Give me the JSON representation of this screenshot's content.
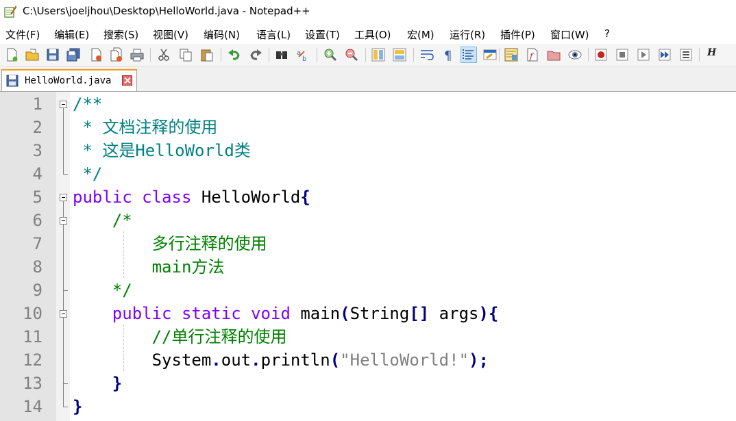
{
  "window": {
    "title": "C:\\Users\\joeljhou\\Desktop\\HelloWorld.java - Notepad++",
    "icon": "notepad-plus-plus-icon"
  },
  "menu": [
    "文件(F)",
    "编辑(E)",
    "搜索(S)",
    "视图(V)",
    "编码(N)",
    "语言(L)",
    "设置(T)",
    "工具(O)",
    "宏(M)",
    "运行(R)",
    "插件(P)",
    "窗口(W)",
    "?"
  ],
  "toolbar": {
    "icons": [
      "new-file-icon",
      "open-file-icon",
      "save-icon",
      "save-all-icon",
      "close-icon",
      "close-all-icon",
      "print-icon",
      "cut-icon",
      "copy-icon",
      "paste-icon",
      "undo-icon",
      "redo-icon",
      "find-icon",
      "replace-icon",
      "zoom-in-icon",
      "zoom-out-icon",
      "sync-vertical-icon",
      "sync-horizontal-icon",
      "word-wrap-icon",
      "show-all-chars-icon",
      "indent-guide-icon",
      "udl-icon",
      "doc-map-icon",
      "function-list-icon",
      "folder-workspace-icon",
      "monitor-icon",
      "record-macro-icon",
      "stop-macro-icon",
      "play-macro-icon",
      "run-macro-multiple-icon",
      "save-macro-icon"
    ],
    "last_label": "H"
  },
  "tab": {
    "label": "HelloWorld.java"
  },
  "editor": {
    "line_numbers": [
      "1",
      "2",
      "3",
      "4",
      "5",
      "6",
      "7",
      "8",
      "9",
      "10",
      "11",
      "12",
      "13",
      "14"
    ],
    "lines": [
      [
        {
          "t": "/**",
          "c": "cmt-doc"
        }
      ],
      [
        {
          "t": " * 文档注释的使用",
          "c": "cmt-doc"
        }
      ],
      [
        {
          "t": " * 这是HelloWorld类",
          "c": "cmt-doc"
        }
      ],
      [
        {
          "t": " */",
          "c": "cmt-doc"
        }
      ],
      [
        {
          "t": "public",
          "c": "kw"
        },
        {
          "t": " ",
          "c": "id"
        },
        {
          "t": "class",
          "c": "kw"
        },
        {
          "t": " HelloWorld",
          "c": "id"
        },
        {
          "t": "{",
          "c": "op"
        }
      ],
      [
        {
          "t": "    /*",
          "c": "cmt"
        }
      ],
      [
        {
          "t": "        多行注释的使用",
          "c": "cmt"
        }
      ],
      [
        {
          "t": "        main方法",
          "c": "cmt"
        }
      ],
      [
        {
          "t": "    */",
          "c": "cmt"
        }
      ],
      [
        {
          "t": "    ",
          "c": "id"
        },
        {
          "t": "public",
          "c": "kw"
        },
        {
          "t": " ",
          "c": "id"
        },
        {
          "t": "static",
          "c": "kw"
        },
        {
          "t": " ",
          "c": "id"
        },
        {
          "t": "void",
          "c": "kw"
        },
        {
          "t": " main",
          "c": "id"
        },
        {
          "t": "(",
          "c": "op"
        },
        {
          "t": "String",
          "c": "id"
        },
        {
          "t": "[]",
          "c": "op"
        },
        {
          "t": " args",
          "c": "id"
        },
        {
          "t": "){",
          "c": "op"
        }
      ],
      [
        {
          "t": "        //单行注释的使用",
          "c": "cmt"
        }
      ],
      [
        {
          "t": "        System",
          "c": "id"
        },
        {
          "t": ".",
          "c": "op"
        },
        {
          "t": "out",
          "c": "id"
        },
        {
          "t": ".",
          "c": "op"
        },
        {
          "t": "println",
          "c": "id"
        },
        {
          "t": "(",
          "c": "op"
        },
        {
          "t": "\"HelloWorld!\"",
          "c": "str"
        },
        {
          "t": ");",
          "c": "op"
        }
      ],
      [
        {
          "t": "    ",
          "c": "id"
        },
        {
          "t": "}",
          "c": "op"
        }
      ],
      [
        {
          "t": "}",
          "c": "op"
        }
      ]
    ]
  }
}
